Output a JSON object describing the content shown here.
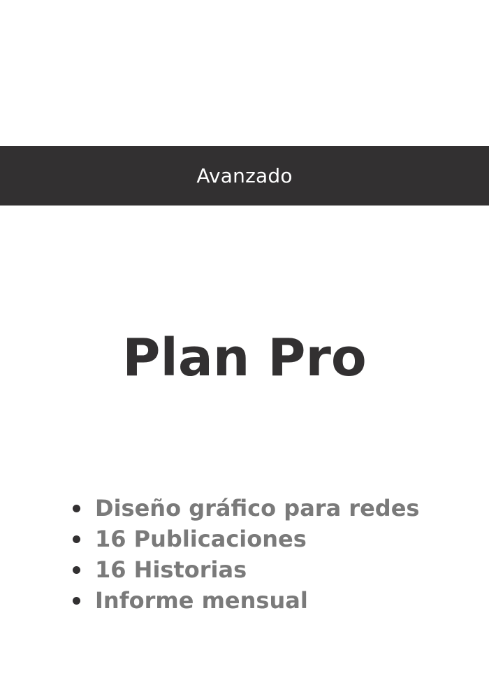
{
  "banner": {
    "label": "Avanzado",
    "background_color": "#323031",
    "text_color": "#ffffff"
  },
  "plan": {
    "title": "Plan Pro",
    "title_color": "#323031"
  },
  "features": {
    "text_color": "#7a7a7a",
    "bullet_color": "#323031",
    "items": [
      "Diseño gráfico para redes",
      "16 Publicaciones",
      "16 Historias",
      "Informe mensual"
    ]
  }
}
